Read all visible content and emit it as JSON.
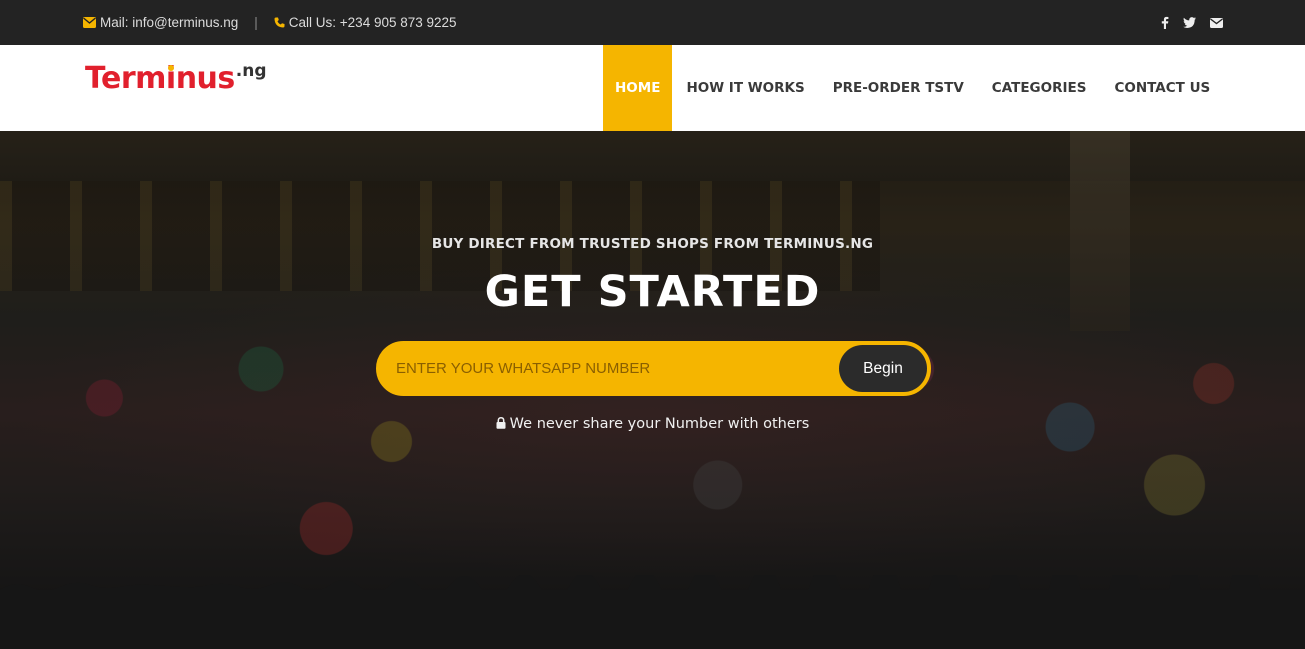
{
  "topbar": {
    "mail_text": "Mail: info@terminus.ng",
    "separator": "|",
    "phone_text": "Call Us: +234 905 873 9225",
    "social_icons": [
      "facebook-icon",
      "twitter-icon",
      "envelope-icon"
    ]
  },
  "logo": {
    "part1": "Term",
    "part_i": "i",
    "part2": "nus",
    "tld": ".ng"
  },
  "nav": {
    "items": [
      {
        "label": "HOME",
        "active": true
      },
      {
        "label": "HOW IT WORKS",
        "active": false
      },
      {
        "label": "PRE-ORDER TSTV",
        "active": false
      },
      {
        "label": "CATEGORIES",
        "active": false
      },
      {
        "label": "CONTACT US",
        "active": false
      }
    ]
  },
  "hero": {
    "subtitle": "BUY DIRECT FROM TRUSTED SHOPS FROM TERMINUS.NG",
    "title": "GET STARTED",
    "input_placeholder": "ENTER YOUR WHATSAPP NUMBER",
    "input_value": "",
    "button_label": "Begin",
    "privacy_text": "We never share your Number with others"
  },
  "colors": {
    "accent": "#f5b500",
    "logo_red": "#e1202d",
    "topbar_bg": "#232323",
    "dark": "#161616"
  }
}
